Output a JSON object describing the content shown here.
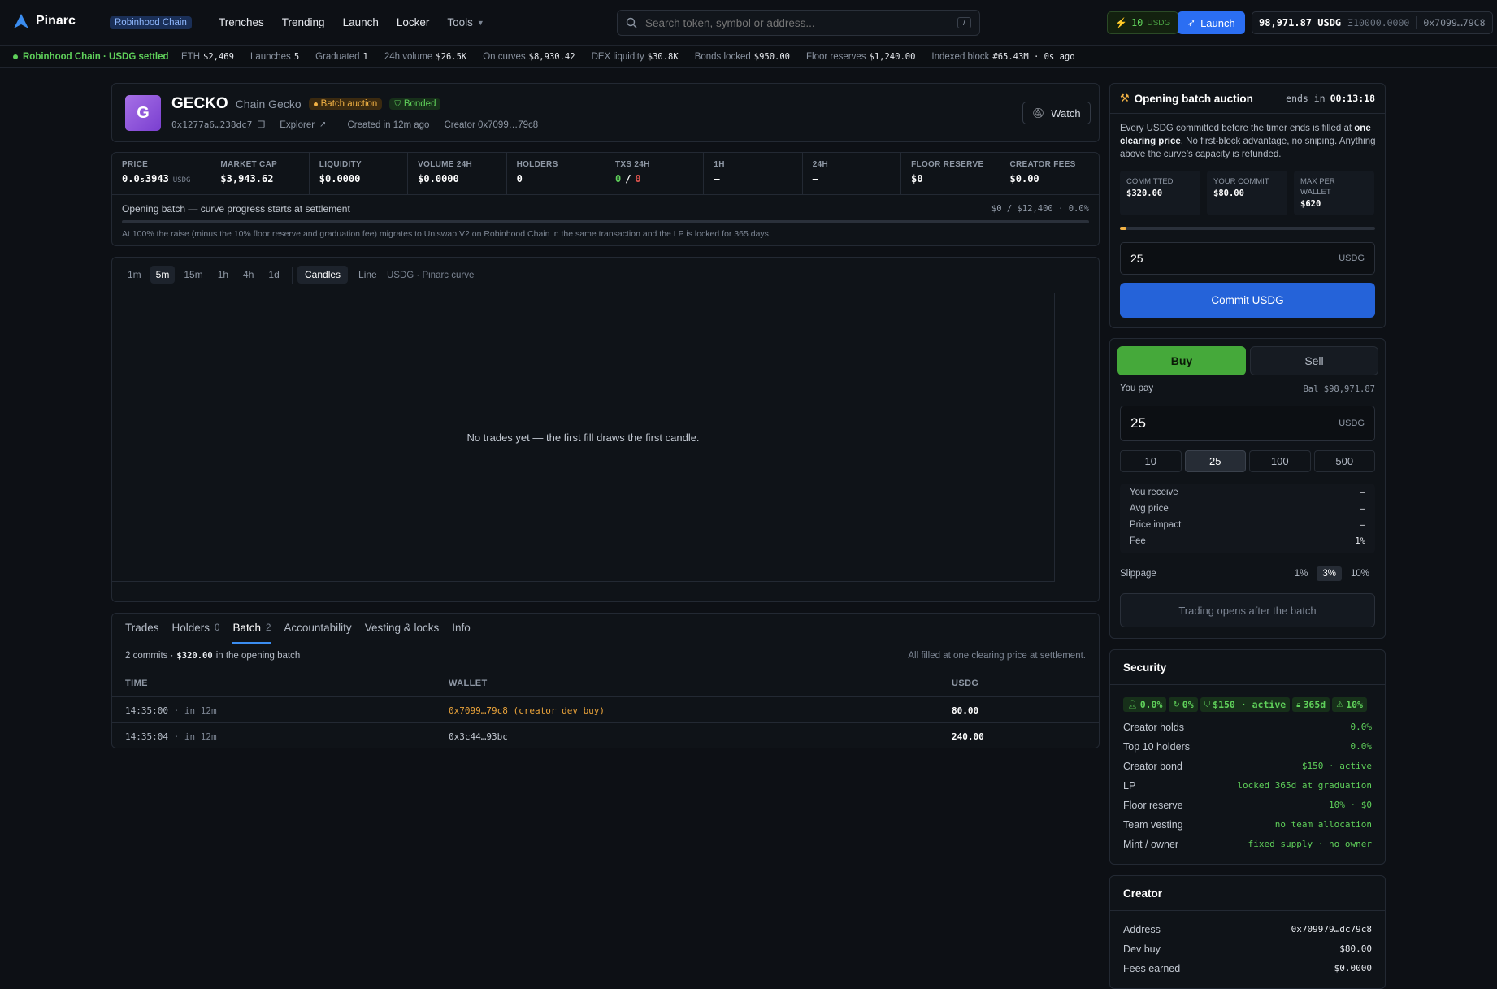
{
  "brand": {
    "name": "Pinarc",
    "chain_badge": "Robinhood Chain"
  },
  "nav": {
    "items": [
      "Trenches",
      "Trending",
      "Launch",
      "Locker",
      "Tools"
    ]
  },
  "search": {
    "placeholder": "Search token, symbol or address...",
    "shortcut": "/"
  },
  "wallet": {
    "points": "10",
    "points_unit": "USDG",
    "launch_label": "Launch",
    "balance": "98,971.87 USDG",
    "balance_alt": "Ξ10000.0000",
    "address": "0x7099…79C8"
  },
  "ticker": {
    "status": "Robinhood Chain · USDG settled",
    "items": [
      {
        "label": "ETH",
        "value": "$2,469"
      },
      {
        "label": "Launches",
        "value": "5"
      },
      {
        "label": "Graduated",
        "value": "1"
      },
      {
        "label": "24h volume",
        "value": "$26.5K"
      },
      {
        "label": "On curves",
        "value": "$8,930.42"
      },
      {
        "label": "DEX liquidity",
        "value": "$30.8K"
      },
      {
        "label": "Bonds locked",
        "value": "$950.00"
      },
      {
        "label": "Floor reserves",
        "value": "$1,240.00"
      },
      {
        "label": "Indexed block",
        "value": "#65.43M · 0s ago"
      }
    ]
  },
  "token": {
    "avatar_letter": "G",
    "symbol": "GECKO",
    "name": "Chain Gecko",
    "badge_auction": "Batch auction",
    "badge_bonded": "Bonded",
    "address": "0x1277a6…238dc7",
    "explorer_label": "Explorer",
    "created": "Created in 12m ago",
    "creator": "Creator 0x7099…79c8",
    "watch_label": "Watch"
  },
  "stats": [
    {
      "label": "PRICE",
      "value": "0.0₅3943",
      "unit": "USDG"
    },
    {
      "label": "MARKET CAP",
      "value": "$3,943.62"
    },
    {
      "label": "LIQUIDITY",
      "value": "$0.0000"
    },
    {
      "label": "VOLUME 24H",
      "value": "$0.0000"
    },
    {
      "label": "HOLDERS",
      "value": "0"
    },
    {
      "label": "TXS 24H",
      "buys": "0",
      "sep": "/",
      "sells": "0"
    },
    {
      "label": "1H",
      "value": "—"
    },
    {
      "label": "24H",
      "value": "—"
    },
    {
      "label": "FLOOR RESERVE",
      "value": "$0"
    },
    {
      "label": "CREATOR FEES",
      "value": "$0.00"
    }
  ],
  "progress": {
    "title": "Opening batch — curve progress starts at settlement",
    "value": "$0 / $12,400 · 0.0%",
    "percent": 0,
    "note": "At 100% the raise (minus the 10% floor reserve and graduation fee) migrates to Uniswap V2 on Robinhood Chain in the same transaction and the LP is locked for 365 days."
  },
  "chart": {
    "intervals": [
      "1m",
      "5m",
      "15m",
      "1h",
      "4h",
      "1d"
    ],
    "active_interval": "5m",
    "modes": [
      "Candles",
      "Line"
    ],
    "active_mode": "Candles",
    "pair_label": "USDG · Pinarc curve",
    "empty_text": "No trades yet — the first fill draws the first candle."
  },
  "tabs": {
    "items": [
      {
        "label": "Trades",
        "count": ""
      },
      {
        "label": "Holders",
        "count": "0"
      },
      {
        "label": "Batch",
        "count": "2"
      },
      {
        "label": "Accountability",
        "count": ""
      },
      {
        "label": "Vesting & locks",
        "count": ""
      },
      {
        "label": "Info",
        "count": ""
      }
    ],
    "active": "Batch"
  },
  "batch": {
    "summary_prefix": "2 commits ·",
    "summary_amount": "$320.00",
    "summary_suffix": "in the opening batch",
    "summary_right": "All filled at one clearing price at settlement.",
    "columns": [
      "TIME",
      "WALLET",
      "USDG"
    ],
    "rows": [
      {
        "time": "14:35:00",
        "rel": "· in 12m",
        "wallet": "0x7099…79c8 (creator dev buy)",
        "amount": "80.00",
        "creator": true
      },
      {
        "time": "14:35:04",
        "rel": "· in 12m",
        "wallet": "0x3c44…93bc",
        "amount": "240.00",
        "creator": false
      }
    ]
  },
  "auction": {
    "title": "Opening batch auction",
    "ends_label": "ends in",
    "ends_value": "00:13:18",
    "desc_1": "Every USDG committed before the timer ends is filled at",
    "desc_bold": "one clearing price",
    "desc_2": ". No first-block advantage, no sniping. Anything above the curve's capacity is refunded.",
    "boxes": [
      {
        "label": "COMMITTED",
        "value": "$320.00"
      },
      {
        "label": "YOUR COMMIT",
        "value": "$80.00"
      },
      {
        "label": "MAX PER WALLET",
        "value": "$620"
      }
    ],
    "fill_percent": 2.5,
    "input_value": "25",
    "input_unit": "USDG",
    "commit_label": "Commit USDG"
  },
  "trade": {
    "buy_label": "Buy",
    "sell_label": "Sell",
    "pay_label": "You pay",
    "bal": "Bal $98,971.87",
    "input_value": "25",
    "input_unit": "USDG",
    "presets": [
      "10",
      "25",
      "100",
      "500"
    ],
    "active_preset": "25",
    "details": [
      {
        "label": "You receive",
        "value": "—"
      },
      {
        "label": "Avg price",
        "value": "—"
      },
      {
        "label": "Price impact",
        "value": "—"
      },
      {
        "label": "Fee",
        "value": "1%"
      }
    ],
    "slippage_label": "Slippage",
    "slippage_options": [
      "1%",
      "3%",
      "10%"
    ],
    "slippage_active": "3%",
    "disabled_label": "Trading opens after the batch"
  },
  "security": {
    "title": "Security",
    "chips": [
      {
        "icon": "user-icon",
        "value": "0.0%"
      },
      {
        "icon": "cycle-icon",
        "value": "0%"
      },
      {
        "icon": "shield-icon",
        "value": "$150 · active"
      },
      {
        "icon": "lock-icon",
        "value": "365d"
      },
      {
        "icon": "warning-icon",
        "value": "10%"
      }
    ],
    "rows": [
      {
        "label": "Creator holds",
        "value": "0.0%"
      },
      {
        "label": "Top 10 holders",
        "value": "0.0%"
      },
      {
        "label": "Creator bond",
        "value": "$150 · active"
      },
      {
        "label": "LP",
        "value": "locked 365d at graduation"
      },
      {
        "label": "Floor reserve",
        "value": "10% · $0"
      },
      {
        "label": "Team vesting",
        "value": "no team allocation"
      },
      {
        "label": "Mint / owner",
        "value": "fixed supply · no owner"
      }
    ]
  },
  "creator_card": {
    "title": "Creator",
    "rows": [
      {
        "label": "Address",
        "value": "0x709979…dc79c8"
      },
      {
        "label": "Dev buy",
        "value": "$80.00"
      },
      {
        "label": "Fees earned",
        "value": "$0.0000"
      }
    ]
  }
}
